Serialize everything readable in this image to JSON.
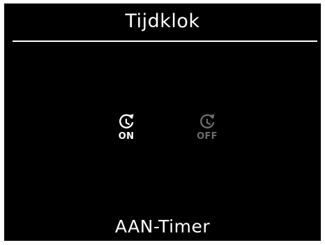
{
  "header": {
    "title": "Tijdklok"
  },
  "timer_options": [
    {
      "label": "ON",
      "icon": "timer-clock-icon",
      "state": "selected",
      "color": "#ffffff"
    },
    {
      "label": "OFF",
      "icon": "timer-clock-icon",
      "state": "unselected",
      "color": "#6c6c6c"
    }
  ],
  "footer": {
    "status": "AAN-Timer"
  },
  "colors": {
    "background": "#000000",
    "text": "#ffffff",
    "inactive": "#6c6c6c"
  }
}
